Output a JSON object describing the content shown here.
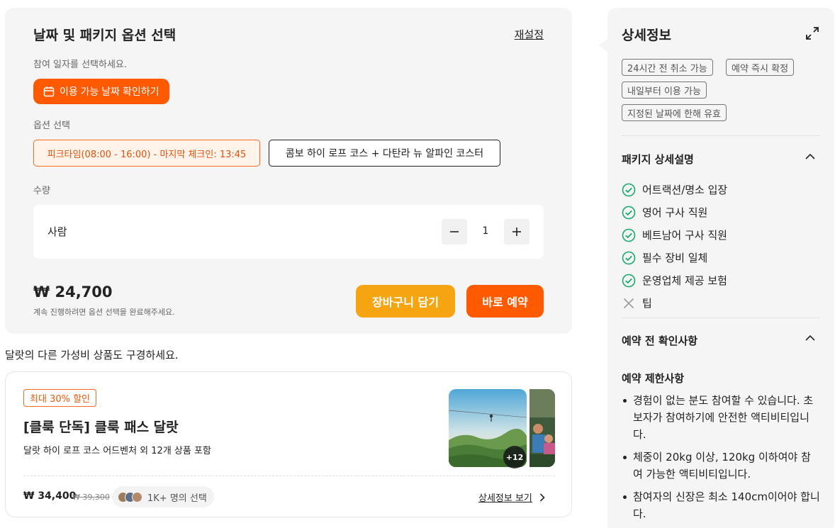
{
  "booking": {
    "title": "날짜 및 패키지 옵션 선택",
    "reset_label": "재설정",
    "date_prompt": "참여 일자를 선택하세요.",
    "date_button_label": "이용 가능 날짜 확인하기",
    "option_label": "옵션 선택",
    "options": [
      {
        "label": "피크타임(08:00 - 16:00) - 마지막 체크인: 13:45",
        "selected": true
      },
      {
        "label": "콤보 하이 로프 코스 + 다탄라 뉴 알파인 코스터",
        "selected": false
      }
    ],
    "quantity_label": "수량",
    "quantity_row": {
      "label": "사람",
      "value": "1"
    },
    "price": "₩ 24,700",
    "price_note": "계속 진행하려면 옵션 선택을 완료해주세요.",
    "cart_label": "장바구니 담기",
    "book_label": "바로 예약",
    "accent_color": "#ff5a00",
    "cart_color": "#f5a512"
  },
  "promo": {
    "heading": "달랏의 다른 가성비 상품도 구경하세요.",
    "badge": "최대 30% 할인",
    "title": "[클룩 단독] 클룩 패스 달랏",
    "subtitle": "달랏 하이 로프 코스 어드벤처 외 12개 상품 포함",
    "price": "₩ 34,400",
    "old_price": "₩ 39,300",
    "social_text": "1K+ 명의 선택",
    "detail_link": "상세정보 보기",
    "more_count": "+12"
  },
  "details": {
    "title": "상세정보",
    "tags": [
      "24시간 전 취소 가능",
      "예약 즉시 확정",
      "내일부터 이용 가능",
      "지정된 날짜에 한해 유효"
    ],
    "package_title": "패키지 상세설명",
    "inclusions": [
      {
        "label": "어트랙션/명소 입장",
        "included": true
      },
      {
        "label": "영어 구사 직원",
        "included": true
      },
      {
        "label": "베트남어 구사 직원",
        "included": true
      },
      {
        "label": "필수 장비 일체",
        "included": true
      },
      {
        "label": "운영업체 제공 보험",
        "included": true
      },
      {
        "label": "팁",
        "included": false
      }
    ],
    "precheck_title": "예약 전 확인사항",
    "restrictions_title": "예약 제한사항",
    "restrictions": [
      "경험이 없는 분도 참여할 수 있습니다. 초보자가 참여하기에 안전한 액티비티입니다.",
      "체중이 20kg 이상, 120kg 이하여야 참여 가능한 액티비티입니다.",
      "참여자의 신장은 최소 140cm이어야 합니다."
    ],
    "check_color": "#1ea672"
  }
}
